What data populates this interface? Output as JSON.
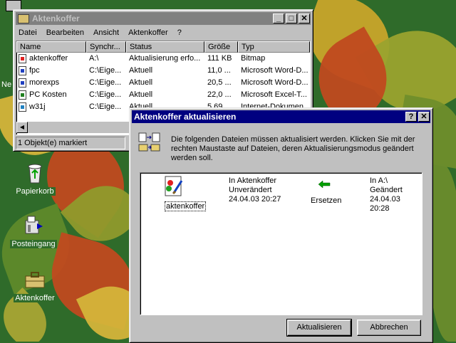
{
  "desktop": {
    "icons": [
      {
        "label": "Papierkorb",
        "icon": "recycle-bin-icon"
      },
      {
        "label": "Posteingang",
        "icon": "inbox-icon"
      },
      {
        "label": "Aktenkoffer",
        "icon": "briefcase-icon"
      }
    ],
    "partial_label": "Ne"
  },
  "explorer": {
    "title": "Aktenkoffer",
    "menu": [
      "Datei",
      "Bearbeiten",
      "Ansicht",
      "Aktenkoffer",
      "?"
    ],
    "columns": [
      "Name",
      "Synchr...",
      "Status",
      "Größe",
      "Typ"
    ],
    "rows": [
      {
        "name": "aktenkoffer",
        "sync": "A:\\",
        "status": "Aktualisierung erfo...",
        "size": "111 KB",
        "type": "Bitmap",
        "icon": "paint-file-icon"
      },
      {
        "name": "fpc",
        "sync": "C:\\Eige...",
        "status": "Aktuell",
        "size": "11,0 ...",
        "type": "Microsoft Word-D...",
        "icon": "word-doc-icon"
      },
      {
        "name": "morexps",
        "sync": "C:\\Eige...",
        "status": "Aktuell",
        "size": "20,5 ...",
        "type": "Microsoft Word-D...",
        "icon": "word-doc-icon"
      },
      {
        "name": "PC Kosten",
        "sync": "C:\\Eige...",
        "status": "Aktuell",
        "size": "22,0 ...",
        "type": "Microsoft Excel-T...",
        "icon": "excel-doc-icon"
      },
      {
        "name": "w31j",
        "sync": "C:\\Eige...",
        "status": "Aktuell",
        "size": "5,69 ...",
        "type": "Internet-Dokumen...",
        "icon": "web-doc-icon"
      }
    ],
    "status": "1 Objekt(e) markiert"
  },
  "dialog": {
    "title": "Aktenkoffer aktualisieren",
    "help_btn": "?",
    "close_btn": "✕",
    "message": "Die folgenden Dateien müssen aktualisiert werden. Klicken Sie mit der rechten Maustaste auf Dateien, deren Aktualisierungsmodus geändert werden soll.",
    "item": {
      "filename": "aktenkoffer",
      "left_line1": "In Aktenkoffer",
      "left_line2": "Unverändert",
      "left_line3": "24.04.03 20:27",
      "action": "Ersetzen",
      "right_line1": "In A:\\",
      "right_line2": "Geändert",
      "right_line3": "24.04.03 20:28"
    },
    "buttons": {
      "update": "Aktualisieren",
      "cancel": "Abbrechen"
    }
  },
  "colors": {
    "title_active": "#000080",
    "title_inactive": "#808080",
    "face": "#c0c0c0",
    "arrow": "#00a000"
  }
}
